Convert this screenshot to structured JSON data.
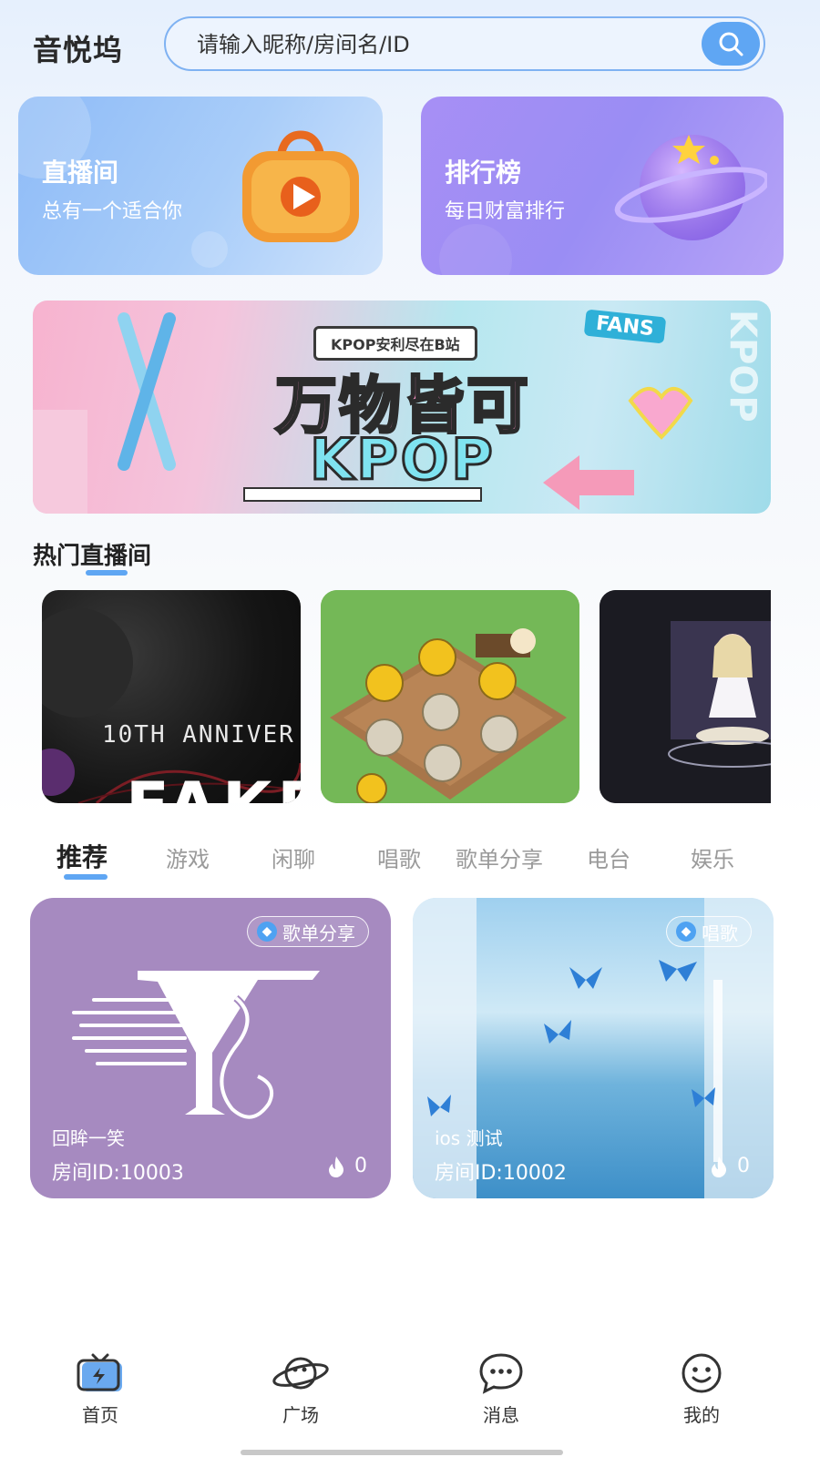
{
  "header": {
    "app_title": "音悦坞",
    "search_placeholder": "请输入昵称/房间名/ID"
  },
  "top_cards": [
    {
      "title": "直播间",
      "subtitle": "总有一个适合你"
    },
    {
      "title": "排行榜",
      "subtitle": "每日财富排行"
    }
  ],
  "banner": {
    "tag": "KPOP安利尽在B站",
    "line1": "万物皆可",
    "line2": "KPOP",
    "fans": "FANS",
    "side": "KPOP"
  },
  "hot_section": {
    "title": "热门直播间",
    "cards": [
      {
        "caption": "10TH ANNIVER",
        "big": "FAKE"
      },
      {
        "caption": ""
      },
      {
        "caption": ""
      }
    ]
  },
  "tabs": [
    "推荐",
    "游戏",
    "闲聊",
    "唱歌",
    "歌单分享",
    "电台",
    "娱乐"
  ],
  "rooms": [
    {
      "badge": "歌单分享",
      "name": "回眸一笑",
      "room_id": "房间ID:10003",
      "heat": "0"
    },
    {
      "badge": "唱歌",
      "name": "ios 测试",
      "room_id": "房间ID:10002",
      "heat": "0"
    }
  ],
  "bottom_nav": [
    "首页",
    "广场",
    "消息",
    "我的"
  ],
  "colors": {
    "accent": "#5fa6f3",
    "room1_bg": "#a68ac0",
    "rank_card": "#a78ff5",
    "live_card": "#8ebbf7"
  }
}
